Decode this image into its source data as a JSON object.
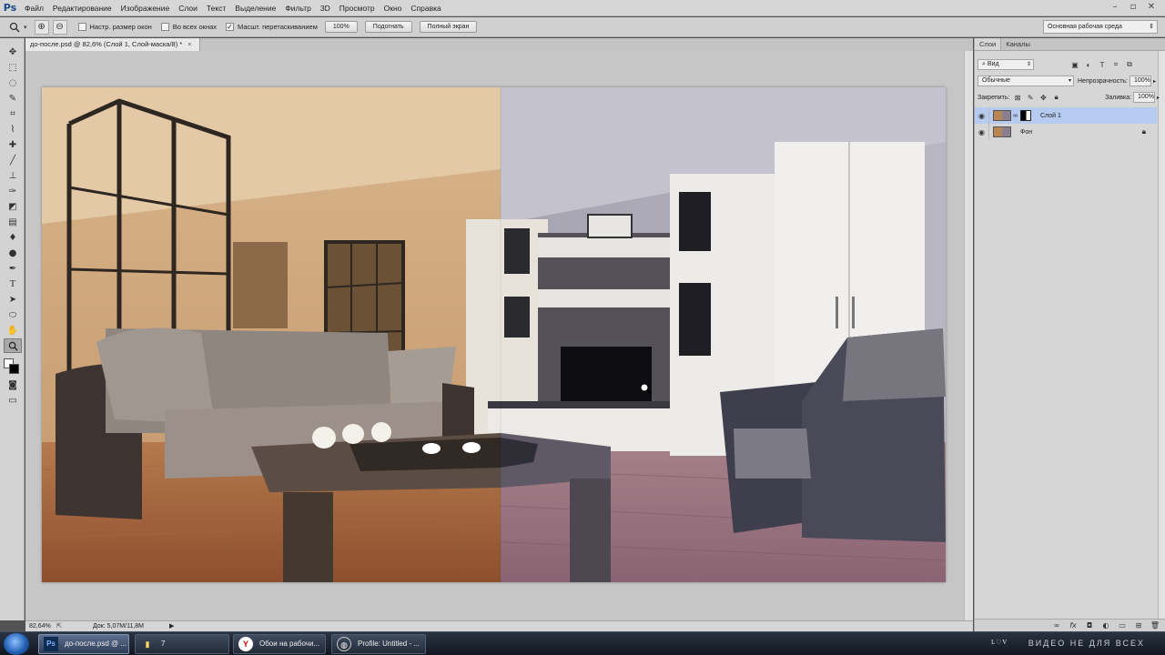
{
  "app": {
    "logo": "Ps",
    "menu": [
      "Файл",
      "Редактирование",
      "Изображение",
      "Слои",
      "Текст",
      "Выделение",
      "Фильтр",
      "3D",
      "Просмотр",
      "Окно",
      "Справка"
    ]
  },
  "options_bar": {
    "resize_windows": "Настр. размер окон",
    "all_windows": "Во всех окнах",
    "scrubby_zoom": "Масшт. перетаскиванием",
    "zoom_value": "100%",
    "fit_label": "Подогнать",
    "fullscreen_label": "Полный экран",
    "workspace": "Основная рабочая среда"
  },
  "document": {
    "tab_title": "до-после.psd @ 82,6% (Слой 1, Слой-маска/8) *",
    "zoom_status": "82,64%",
    "doc_status": "Док: 5,07M/11,8M"
  },
  "layers_panel": {
    "tabs": [
      "Слои",
      "Каналы"
    ],
    "filter": "Вид",
    "blend_mode": "Обычные",
    "opacity_label": "Непрозрачность:",
    "opacity_value": "100%",
    "lock_label": "Закрепить:",
    "fill_label": "Заливка:",
    "fill_value": "100%",
    "layers": [
      {
        "name": "Слой 1",
        "selected": true,
        "has_mask": true
      },
      {
        "name": "Фон",
        "selected": false,
        "locked": true
      }
    ]
  },
  "taskbar": {
    "items": [
      {
        "label": "до-после.psd @ ...",
        "icon": "photoshop-icon"
      },
      {
        "label": "7",
        "icon": "folder-icon"
      },
      {
        "label": "Обои на рабочи...",
        "icon": "yandex-browser-icon"
      },
      {
        "label": "Profile: Untitled - ...",
        "icon": "obs-icon"
      }
    ],
    "watermark": "ВИДЕО НЕ ДЛЯ ВСЕХ"
  },
  "colors": {
    "warm_half": "#c79866",
    "cool_half": "#9c98a8",
    "selection": "#b6cbef"
  }
}
